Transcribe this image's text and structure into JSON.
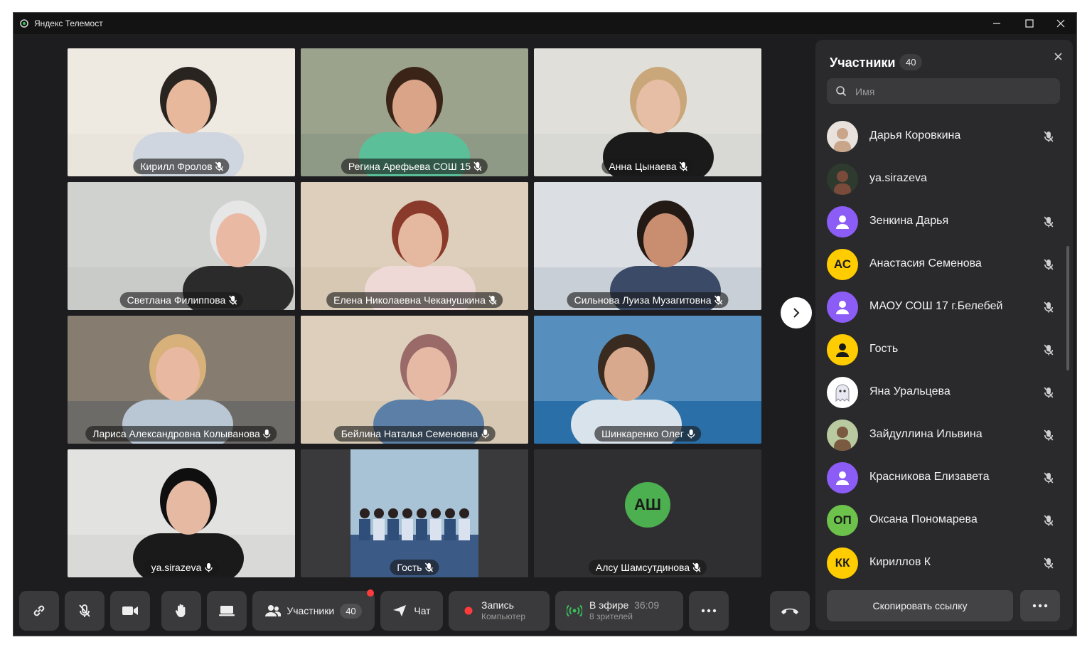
{
  "window": {
    "title": "Яндекс Телемост"
  },
  "tiles": [
    {
      "name": "Кирилл Фролов",
      "mic": "muted"
    },
    {
      "name": "Регина Арефьева СОШ 15",
      "mic": "muted"
    },
    {
      "name": "Анна Цынаева",
      "mic": "muted"
    },
    {
      "name": "Светлана Филиппова",
      "mic": "muted"
    },
    {
      "name": "Елена Николаевна Чеканушкина",
      "mic": "muted"
    },
    {
      "name": "Сильнова Луиза Музагитовна",
      "mic": "muted"
    },
    {
      "name": "Лариса Александровна Колыванова",
      "mic": "on"
    },
    {
      "name": "Бейлина Наталья Семеновна",
      "mic": "on",
      "speaking": true
    },
    {
      "name": "Шинкаренко Олег",
      "mic": "on"
    },
    {
      "name": "ya.sirazeva",
      "mic": "on"
    },
    {
      "name": "Гость",
      "mic": "muted"
    },
    {
      "name": "Алсу Шамсутдинова",
      "mic": "muted",
      "initials": "АШ",
      "initials_color": "#4caf50"
    }
  ],
  "sidebar": {
    "title": "Участники",
    "count": "40",
    "search_placeholder": "Имя",
    "participants": [
      {
        "name": "Дарья Коровкина",
        "avatar": "photo",
        "mic": "muted"
      },
      {
        "name": "ya.sirazeva",
        "avatar": "photo",
        "mic": "none"
      },
      {
        "name": "Зенкина Дарья",
        "avatar": "user-icon",
        "color": "#8c5cf6",
        "mic": "muted"
      },
      {
        "name": "Анастасия Семенова",
        "avatar": "initials",
        "initials": "АС",
        "color": "#ffcc00",
        "mic": "muted"
      },
      {
        "name": "МАОУ СОШ 17 г.Белебей",
        "avatar": "user-icon",
        "color": "#8c5cf6",
        "mic": "muted"
      },
      {
        "name": "Гость",
        "avatar": "user-icon",
        "color": "#ffcc00",
        "mic": "muted"
      },
      {
        "name": "Яна Уральцева",
        "avatar": "ghost",
        "color": "#ffffff",
        "mic": "muted"
      },
      {
        "name": "Зайдуллина Ильвина",
        "avatar": "photo",
        "mic": "muted"
      },
      {
        "name": "Красникова Елизавета",
        "avatar": "user-icon",
        "color": "#8c5cf6",
        "mic": "muted"
      },
      {
        "name": "Оксана Пономарева",
        "avatar": "initials",
        "initials": "ОП",
        "color": "#6cc24a",
        "mic": "muted"
      },
      {
        "name": "Кириллов К",
        "avatar": "initials",
        "initials": "КК",
        "color": "#ffcc00",
        "mic": "muted"
      }
    ],
    "copy_link_label": "Скопировать ссылку"
  },
  "toolbar": {
    "participants_label": "Участники",
    "participants_count": "40",
    "chat_label": "Чат",
    "record_label": "Запись",
    "record_sub": "Компьютер",
    "live_label": "В эфире",
    "live_time": "36:09",
    "live_viewers": "8 зрителей"
  },
  "colors": {
    "accent_active": "#2ec94a",
    "record": "#ff3b3b",
    "live": "#39c15a"
  }
}
